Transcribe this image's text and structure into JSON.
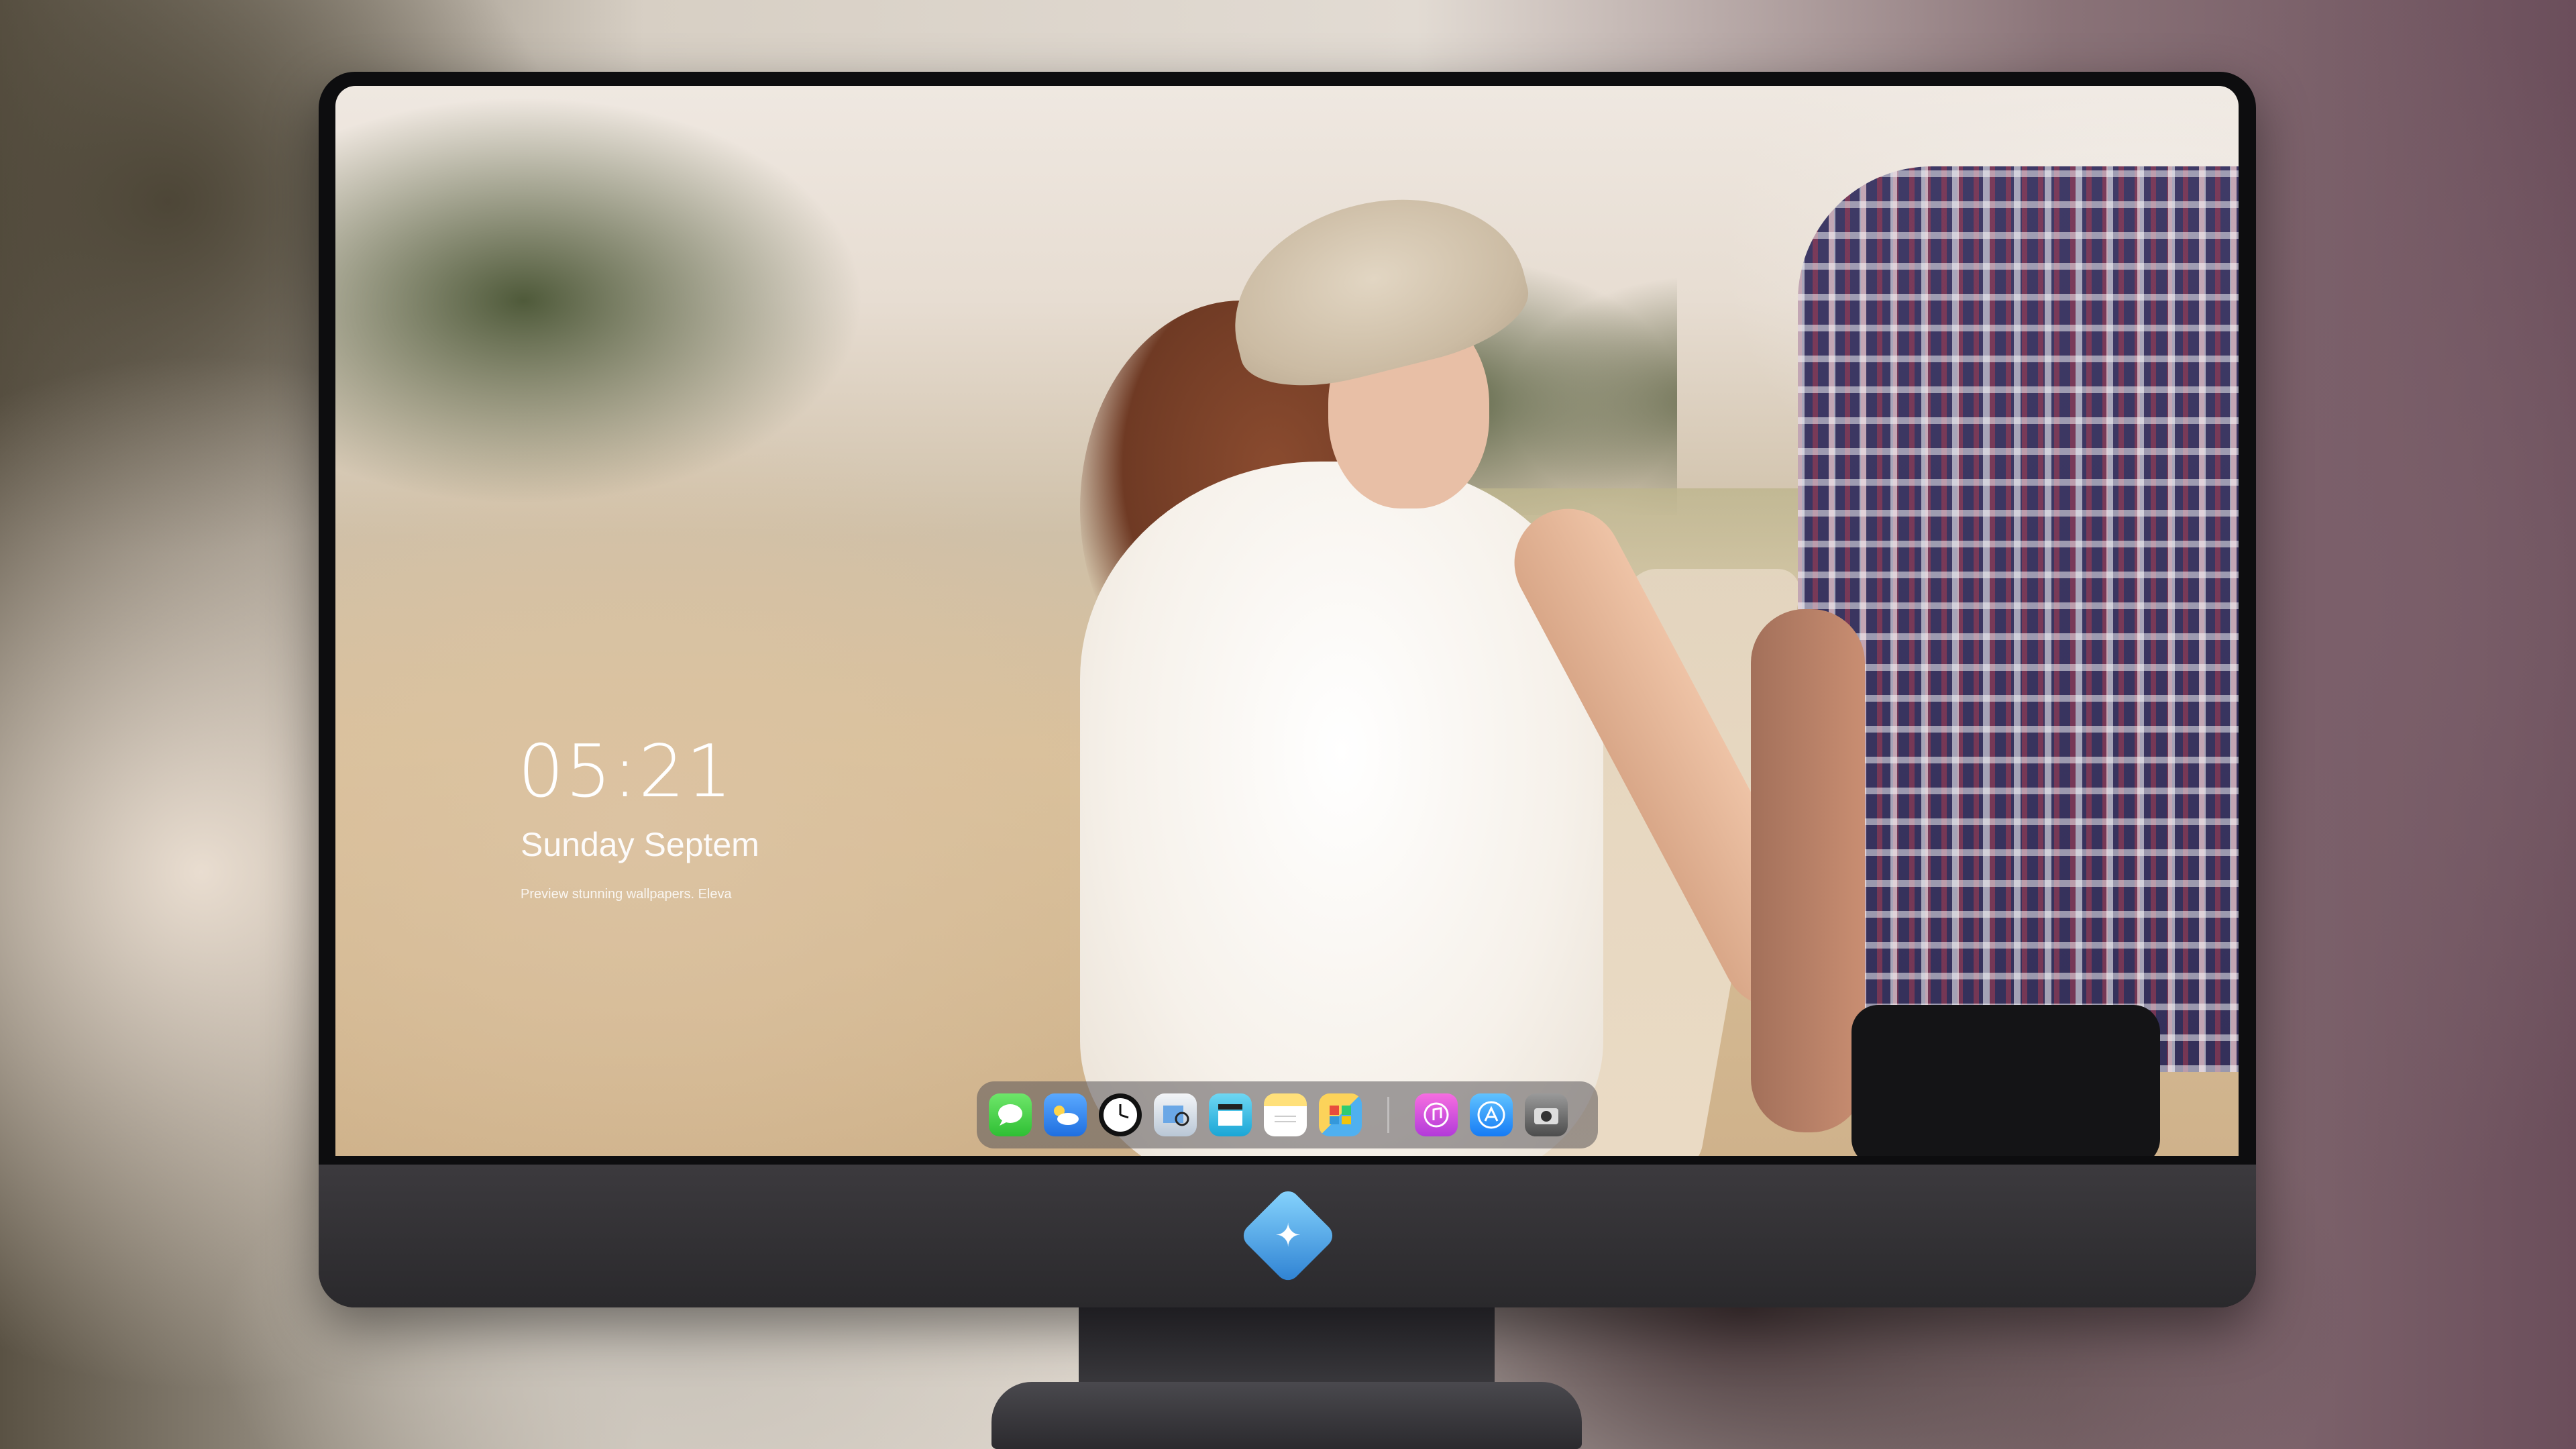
{
  "lock_screen": {
    "time": "05:21",
    "date": "Sunday Septem",
    "tagline": "Preview stunning wallpapers. Eleva"
  },
  "dock": {
    "apps": [
      {
        "name": "Messages",
        "icon": "messages-icon"
      },
      {
        "name": "Weather",
        "icon": "weather-icon"
      },
      {
        "name": "Clock",
        "icon": "clock-icon"
      },
      {
        "name": "Preview",
        "icon": "preview-icon"
      },
      {
        "name": "Video",
        "icon": "clapperboard-icon"
      },
      {
        "name": "Notes",
        "icon": "notes-icon"
      },
      {
        "name": "Photos",
        "icon": "photos-icon"
      },
      {
        "name": "Music",
        "icon": "music-icon"
      },
      {
        "name": "App Store",
        "icon": "app-store-icon"
      },
      {
        "name": "Camera",
        "icon": "camera-icon"
      }
    ]
  },
  "brand": {
    "logo": "mascot-logo-icon"
  },
  "colors": {
    "bezel": "#0d0d0f",
    "chin": "#35343a",
    "dock": "#5a555a"
  }
}
